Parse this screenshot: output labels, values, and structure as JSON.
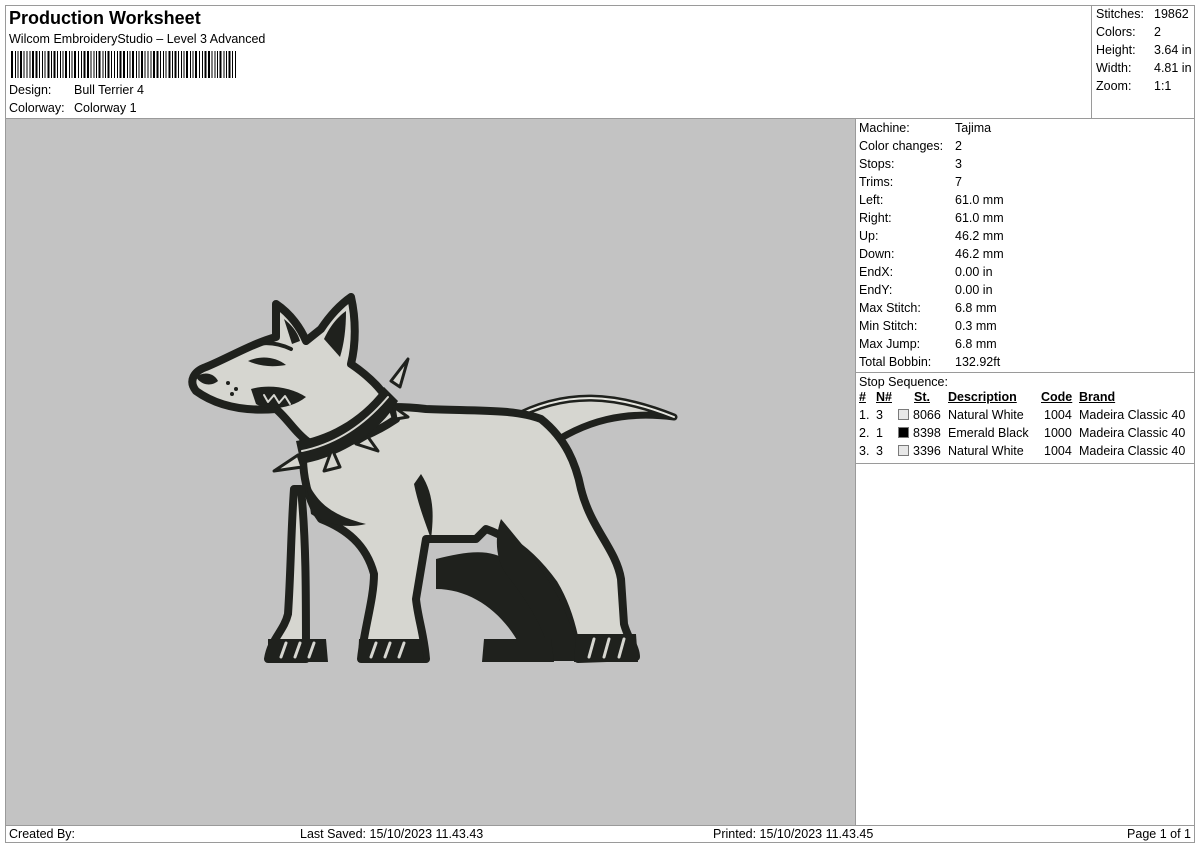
{
  "header": {
    "title": "Production Worksheet",
    "software": "Wilcom EmbroideryStudio – Level 3 Advanced",
    "design_label": "Design:",
    "design_value": "Bull Terrier 4",
    "colorway_label": "Colorway:",
    "colorway_value": "Colorway 1"
  },
  "stats": [
    {
      "label": "Stitches:",
      "value": "19862"
    },
    {
      "label": "Colors:",
      "value": "2"
    },
    {
      "label": "Height:",
      "value": "3.64 in"
    },
    {
      "label": "Width:",
      "value": "4.81 in"
    },
    {
      "label": "Zoom:",
      "value": "1:1"
    }
  ],
  "machine_info": [
    {
      "label": "Machine:",
      "value": "Tajima"
    },
    {
      "label": "Color changes:",
      "value": "2"
    },
    {
      "label": "Stops:",
      "value": "3"
    },
    {
      "label": "Trims:",
      "value": "7"
    },
    {
      "label": "Left:",
      "value": "61.0 mm"
    },
    {
      "label": "Right:",
      "value": "61.0 mm"
    },
    {
      "label": "Up:",
      "value": "46.2 mm"
    },
    {
      "label": "Down:",
      "value": "46.2 mm"
    },
    {
      "label": "EndX:",
      "value": "0.00 in"
    },
    {
      "label": "EndY:",
      "value": "0.00 in"
    },
    {
      "label": "Max Stitch:",
      "value": "6.8 mm"
    },
    {
      "label": "Min Stitch:",
      "value": "0.3 mm"
    },
    {
      "label": "Max Jump:",
      "value": "6.8 mm"
    },
    {
      "label": "Total Bobbin:",
      "value": "132.92ft"
    }
  ],
  "stop_sequence": {
    "title": "Stop Sequence:",
    "headers": {
      "num": "#",
      "n": "N#",
      "st": "St.",
      "description": "Description",
      "code": "Code",
      "brand": "Brand"
    },
    "rows": [
      {
        "num": "1.",
        "n": "3",
        "swatch": "#e8e8e8",
        "st": "8066",
        "description": "Natural White",
        "code": "1004",
        "brand": "Madeira Classic 40"
      },
      {
        "num": "2.",
        "n": "1",
        "swatch": "#000000",
        "st": "8398",
        "description": "Emerald Black",
        "code": "1000",
        "brand": "Madeira Classic 40"
      },
      {
        "num": "3.",
        "n": "3",
        "swatch": "#e8e8e8",
        "st": "3396",
        "description": "Natural White",
        "code": "1004",
        "brand": "Madeira Classic 40"
      }
    ]
  },
  "footer": {
    "created_by": "Created By:",
    "last_saved": "Last Saved: 15/10/2023 11.43.43",
    "printed": "Printed: 15/10/2023 11.43.45",
    "page": "Page 1 of 1"
  },
  "colors": {
    "preview_bg": "#c3c3c3",
    "thread_white": "#d6d6d0",
    "thread_black": "#1f211d",
    "border": "#9a9a9a"
  }
}
